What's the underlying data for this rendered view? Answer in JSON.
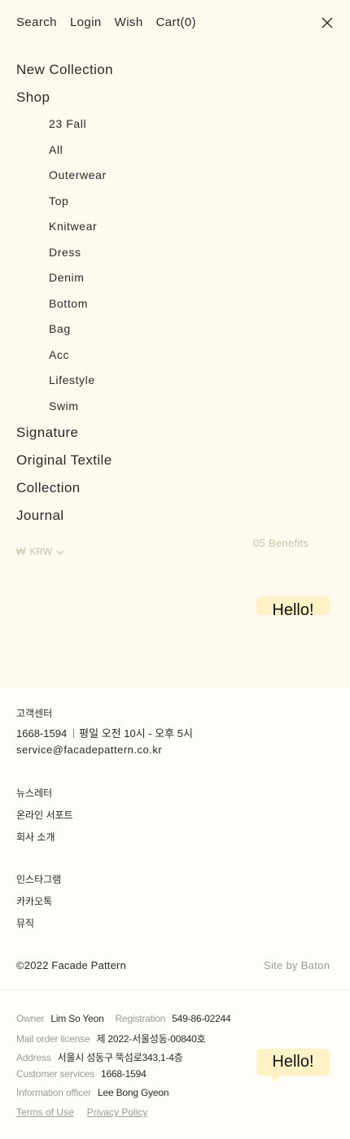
{
  "topnav": {
    "search": "Search",
    "login": "Login",
    "wish": "Wish",
    "cart": "Cart(0)"
  },
  "menu": {
    "new_collection": "New Collection",
    "shop": "Shop",
    "shop_items": [
      "23 Fall",
      "All",
      "Outerwear",
      "Top",
      "Knitwear",
      "Dress",
      "Denim",
      "Bottom",
      "Bag",
      "Acc",
      "Lifestyle",
      "Swim"
    ],
    "signature": "Signature",
    "original_textile": "Original Textile",
    "collection": "Collection",
    "journal": "Journal"
  },
  "currency": {
    "symbol": "₩",
    "code": "KRW"
  },
  "benefits": "05 Benefits",
  "hello": "Hello!",
  "footer": {
    "cs_title": "고객센터",
    "phone": "1668-1594",
    "hours": "평일 오전 10시 - 오후 5시",
    "email": "service@facadepattern.co.kr",
    "links1": [
      "뉴스레터",
      "온라인 서포트",
      "회사 소개"
    ],
    "links2": [
      "인스타그램",
      "카카오톡",
      "뮤직"
    ],
    "copyright": "©2022 Facade Pattern",
    "site_by": "Site by Baton"
  },
  "company": {
    "owner_label": "Owner",
    "owner": "Lim So Yeon",
    "registration_label": "Registration",
    "registration": "549-86-02244",
    "mail_order_label": "Mail order license",
    "mail_order": "제 2022-서울성동-00840호",
    "address_label": "Address",
    "address": "서울시 성동구 뚝섬로343,1-4층",
    "cs_label": "Customer services",
    "cs_phone": "1668-1594",
    "officer_label": "Information officer",
    "officer": "Lee Bong Gyeon",
    "terms": "Terms of Use",
    "privacy": "Privacy Policy"
  }
}
